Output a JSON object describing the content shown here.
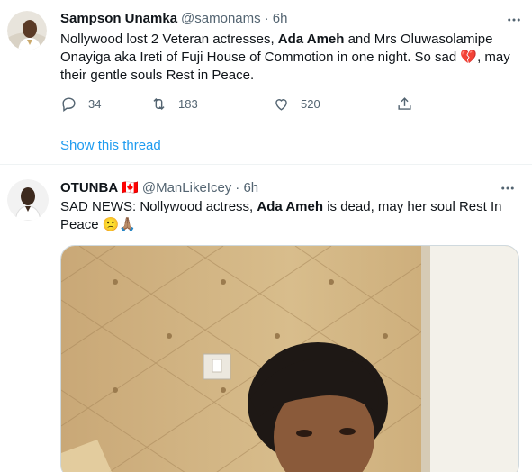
{
  "tweet1": {
    "name": "Sampson Unamka",
    "handle": "@samonams",
    "time": "· 6h",
    "text_a": "Nollywood lost 2 Veteran actresses, ",
    "text_bold": "Ada Ameh",
    "text_b": " and Mrs Oluwasolamipe Onayiga aka Ireti of Fuji House of Commotion in one night. So sad ",
    "emoji": "💔",
    "text_c": ", may their gentle souls Rest in Peace.",
    "replies": "34",
    "retweets": "183",
    "likes": "520",
    "show_thread": "Show this thread",
    "icons": [
      "more-icon",
      "reply-icon",
      "retweet-icon",
      "like-icon",
      "share-icon"
    ]
  },
  "tweet2": {
    "name": "OTUNBA",
    "flag": "🇨🇦",
    "handle": "@ManLikeIcey",
    "time": "· 6h",
    "text_a": "SAD NEWS: Nollywood actress, ",
    "text_bold": "Ada Ameh",
    "text_b": " is dead, may her soul Rest In Peace ",
    "emoji": "🙁🙏🏽"
  },
  "colors": {
    "accent": "#1d9bf0",
    "secondary_text": "#536471",
    "divider": "#eff3f4"
  }
}
